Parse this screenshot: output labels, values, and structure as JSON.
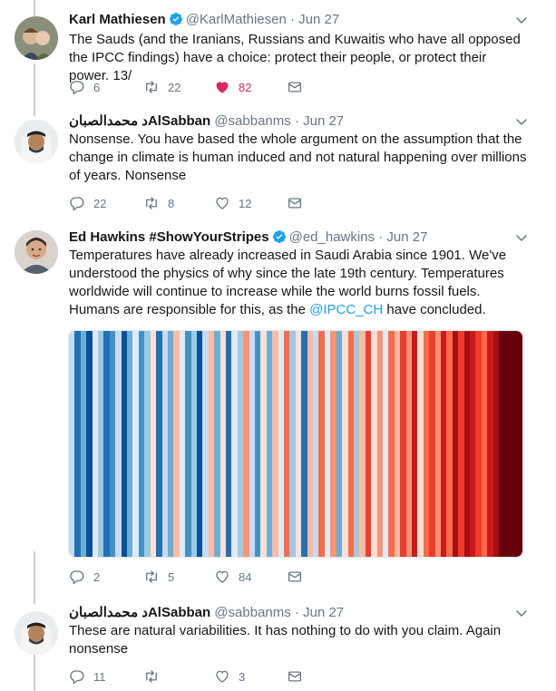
{
  "tweets": [
    {
      "name": "Karl Mathiesen",
      "verified": true,
      "handle": "@KarlMathiesen",
      "date": "Jun 27",
      "text": "The Sauds (and the Iranians, Russians and Kuwaitis who have all opposed the IPCC findings) have a choice: protect their people, or protect their power. 13/",
      "replies": "6",
      "retweets": "22",
      "likes": "82",
      "liked": true
    },
    {
      "name": "د محمدالصبانAlSabban",
      "verified": false,
      "handle": "@sabbanms",
      "date": "Jun 27",
      "text": "Nonsense. You have based the whole argument on the assumption that the change in climate is human induced and not natural happening over millions of years. Nonsense",
      "replies": "22",
      "retweets": "8",
      "likes": "12",
      "liked": false
    },
    {
      "name": "Ed Hawkins #ShowYourStripes",
      "verified": true,
      "handle": "@ed_hawkins",
      "date": "Jun 27",
      "text_before": "Temperatures have already increased in Saudi Arabia since 1901. We've understood the physics of why since the late 19th century. Temperatures worldwide will continue to increase while the world burns fossil fuels. Humans are responsible for this, as the ",
      "mention": "@IPCC_CH",
      "text_after": " have concluded.",
      "replies": "2",
      "retweets": "5",
      "likes": "84",
      "liked": false
    },
    {
      "name": "د محمدالصبانAlSabban",
      "verified": false,
      "handle": "@sabbanms",
      "date": "Jun 27",
      "text": "These are natural variabilities. It has nothing to do with you claim. Again nonsense",
      "replies": "11",
      "retweets": "",
      "likes": "3",
      "liked": false
    }
  ],
  "separator": "·",
  "colors": {
    "accent": "#1da1f2",
    "like": "#e0245e",
    "muted": "#657786",
    "thread_line": "#c4cfd6"
  },
  "stripes": [
    "#c6dbef",
    "#2171b5",
    "#6baed6",
    "#08519c",
    "#deebf7",
    "#9ecae1",
    "#2171b5",
    "#4292c6",
    "#c6dbef",
    "#08519c",
    "#6baed6",
    "#deebf7",
    "#4292c6",
    "#9ecae1",
    "#fee0d2",
    "#2171b5",
    "#c6dbef",
    "#6baed6",
    "#fcbba1",
    "#deebf7",
    "#4292c6",
    "#9ecae1",
    "#08519c",
    "#c6dbef",
    "#fcbba1",
    "#6baed6",
    "#fee0d2",
    "#2171b5",
    "#deebf7",
    "#9ecae1",
    "#fc9272",
    "#c6dbef",
    "#4292c6",
    "#fee0d2",
    "#6baed6",
    "#fcbba1",
    "#deebf7",
    "#fb6a4a",
    "#9ecae1",
    "#fee0d2",
    "#2171b5",
    "#fcbba1",
    "#c6dbef",
    "#fb6a4a",
    "#deebf7",
    "#fc9272",
    "#6baed6",
    "#fee0d2",
    "#fb6a4a",
    "#9ecae1",
    "#fcbba1",
    "#ef3b2c",
    "#fee0d2",
    "#fc9272",
    "#deebf7",
    "#fb6a4a",
    "#fcbba1",
    "#ef3b2c",
    "#fc9272",
    "#cb181d",
    "#fee0d2",
    "#fb6a4a",
    "#ef3b2c",
    "#fc9272",
    "#cb181d",
    "#fb6a4a",
    "#a50f15",
    "#ef3b2c",
    "#a50f15",
    "#cb181d",
    "#ef3b2c",
    "#fb6a4a",
    "#cb181d",
    "#a50f15",
    "#67000d",
    "#67000d",
    "#67000d",
    "#67000d"
  ]
}
